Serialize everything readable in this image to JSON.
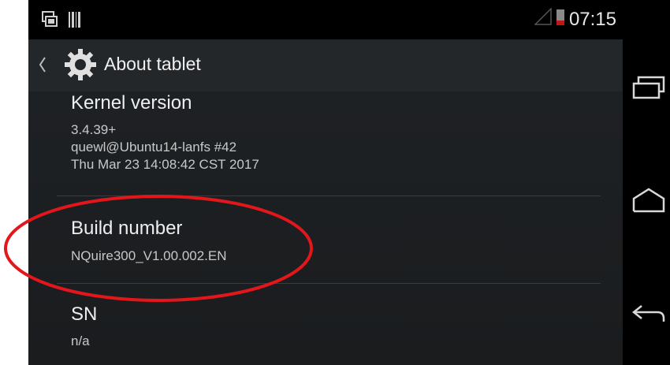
{
  "status": {
    "time": "07:15"
  },
  "actionbar": {
    "title": "About tablet"
  },
  "items": [
    {
      "title": "Kernel version",
      "lines": [
        "3.4.39+",
        "quewl@Ubuntu14-lanfs #42",
        "Thu Mar 23 14:08:42 CST 2017"
      ]
    },
    {
      "title": "Build number",
      "lines": [
        "NQuire300_V1.00.002.EN"
      ]
    },
    {
      "title": "SN",
      "lines": [
        "n/a"
      ]
    }
  ],
  "colors": {
    "annotation": "#e3171b",
    "background": "#1b1d1f"
  }
}
